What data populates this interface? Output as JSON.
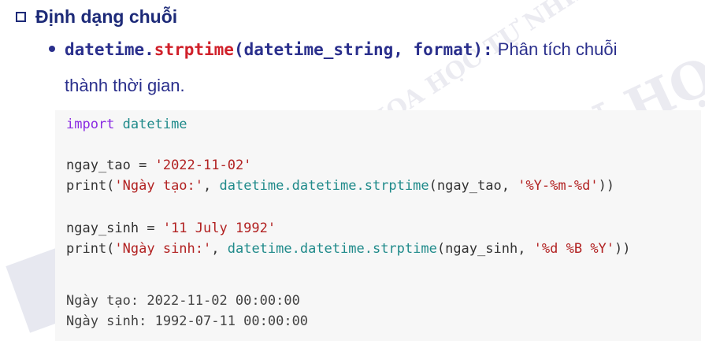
{
  "heading": {
    "title": "Định dạng chuỗi"
  },
  "bullet": {
    "func_prefix": "datetime.",
    "func_name": "strptime",
    "func_args": "(datetime_string, format):",
    "description_1": " Phân tích chuỗi",
    "description_2": "thành thời gian."
  },
  "code": {
    "line1_kw": "import",
    "line1_mod": " datetime",
    "line2_var": "ngay_tao = ",
    "line2_str": "'2022-11-02'",
    "line3_a": "print(",
    "line3_str1": "'Ngày tạo:'",
    "line3_b": ", ",
    "line3_mod": "datetime.datetime.strptime",
    "line3_c": "(ngay_tao, ",
    "line3_str2": "'%Y-%m-%d'",
    "line3_d": "))",
    "line4_var": "ngay_sinh = ",
    "line4_str": "'11 July 1992'",
    "line5_a": "print(",
    "line5_str1": "'Ngày sinh:'",
    "line5_b": ", ",
    "line5_mod": "datetime.datetime.strptime",
    "line5_c": "(ngay_sinh, ",
    "line5_str2": "'%d %B %Y'",
    "line5_d": "))",
    "output1": "Ngày tạo: 2022-11-02 00:00:00",
    "output2": "Ngày sinh: 1992-07-11 00:00:00"
  },
  "watermark": {
    "line1": "TRƯỜNG ĐẠI HỌC KHOA HỌC TỰ NHIÊN",
    "line2": "TRUNG TÂM TIN HỌC"
  }
}
